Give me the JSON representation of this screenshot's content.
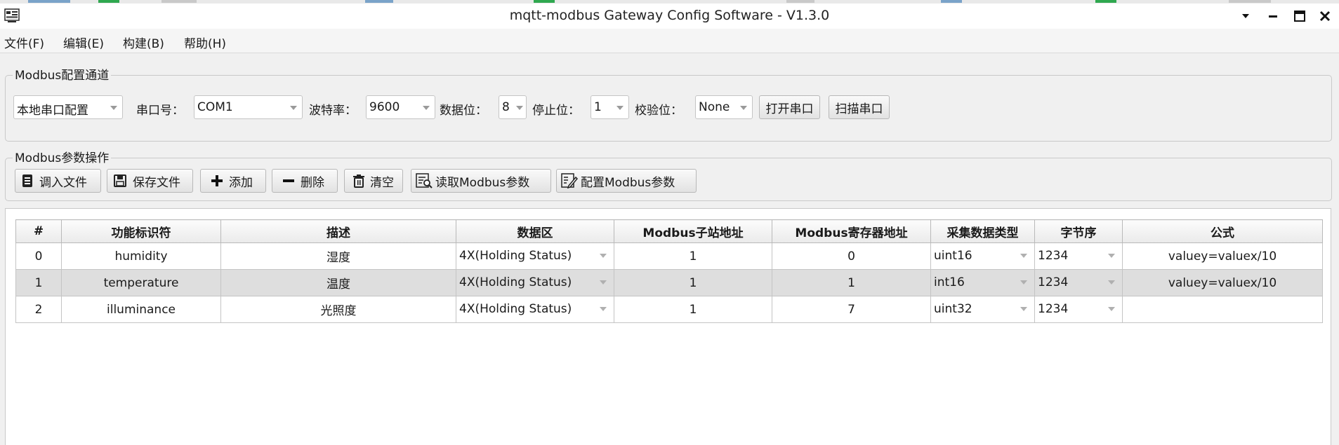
{
  "window": {
    "title": "mqtt-modbus Gateway Config Software - V1.3.0"
  },
  "menu": [
    "文件(F)",
    "编辑(E)",
    "构建(B)",
    "帮助(H)"
  ],
  "channel_group": {
    "title": "Modbus配置通道",
    "mode": "本地串口配置",
    "port_label": "串口号：",
    "port": "COM1",
    "baud_label": "波特率：",
    "baud": "9600",
    "databits_label": "数据位：",
    "databits": "8",
    "stopbits_label": "停止位：",
    "stopbits": "1",
    "parity_label": "校验位：",
    "parity": "None",
    "open_button": "打开串口",
    "scan_button": "扫描串口"
  },
  "param_group": {
    "title": "Modbus参数操作",
    "buttons": {
      "load": "调入文件",
      "save": "保存文件",
      "add": "添加",
      "delete": "删除",
      "clear": "清空",
      "read": "读取Modbus参数",
      "config": "配置Modbus参数"
    }
  },
  "table": {
    "columns": [
      "#",
      "功能标识符",
      "描述",
      "数据区",
      "Modbus子站地址",
      "Modbus寄存器地址",
      "采集数据类型",
      "字节序",
      "公式"
    ],
    "rows": [
      {
        "index": "0",
        "id": "humidity",
        "desc": "湿度",
        "area": "4X(Holding Status)",
        "slave": "1",
        "reg": "0",
        "dtype": "uint16",
        "order": "1234",
        "formula": "valuey=valuex/10"
      },
      {
        "index": "1",
        "id": "temperature",
        "desc": "温度",
        "area": "4X(Holding Status)",
        "slave": "1",
        "reg": "1",
        "dtype": "int16",
        "order": "1234",
        "formula": "valuey=valuex/10"
      },
      {
        "index": "2",
        "id": "illuminance",
        "desc": "光照度",
        "area": "4X(Holding Status)",
        "slave": "1",
        "reg": "7",
        "dtype": "uint32",
        "order": "1234",
        "formula": ""
      }
    ],
    "selected_row": 1
  },
  "icons": [
    "app-icon",
    "menu-dropdown-icon",
    "minimize-icon",
    "maximize-icon",
    "close-icon",
    "document-icon",
    "save-icon",
    "plus-icon",
    "minus-icon",
    "trash-icon",
    "read-icon",
    "config-icon",
    "chevron-down-icon"
  ]
}
